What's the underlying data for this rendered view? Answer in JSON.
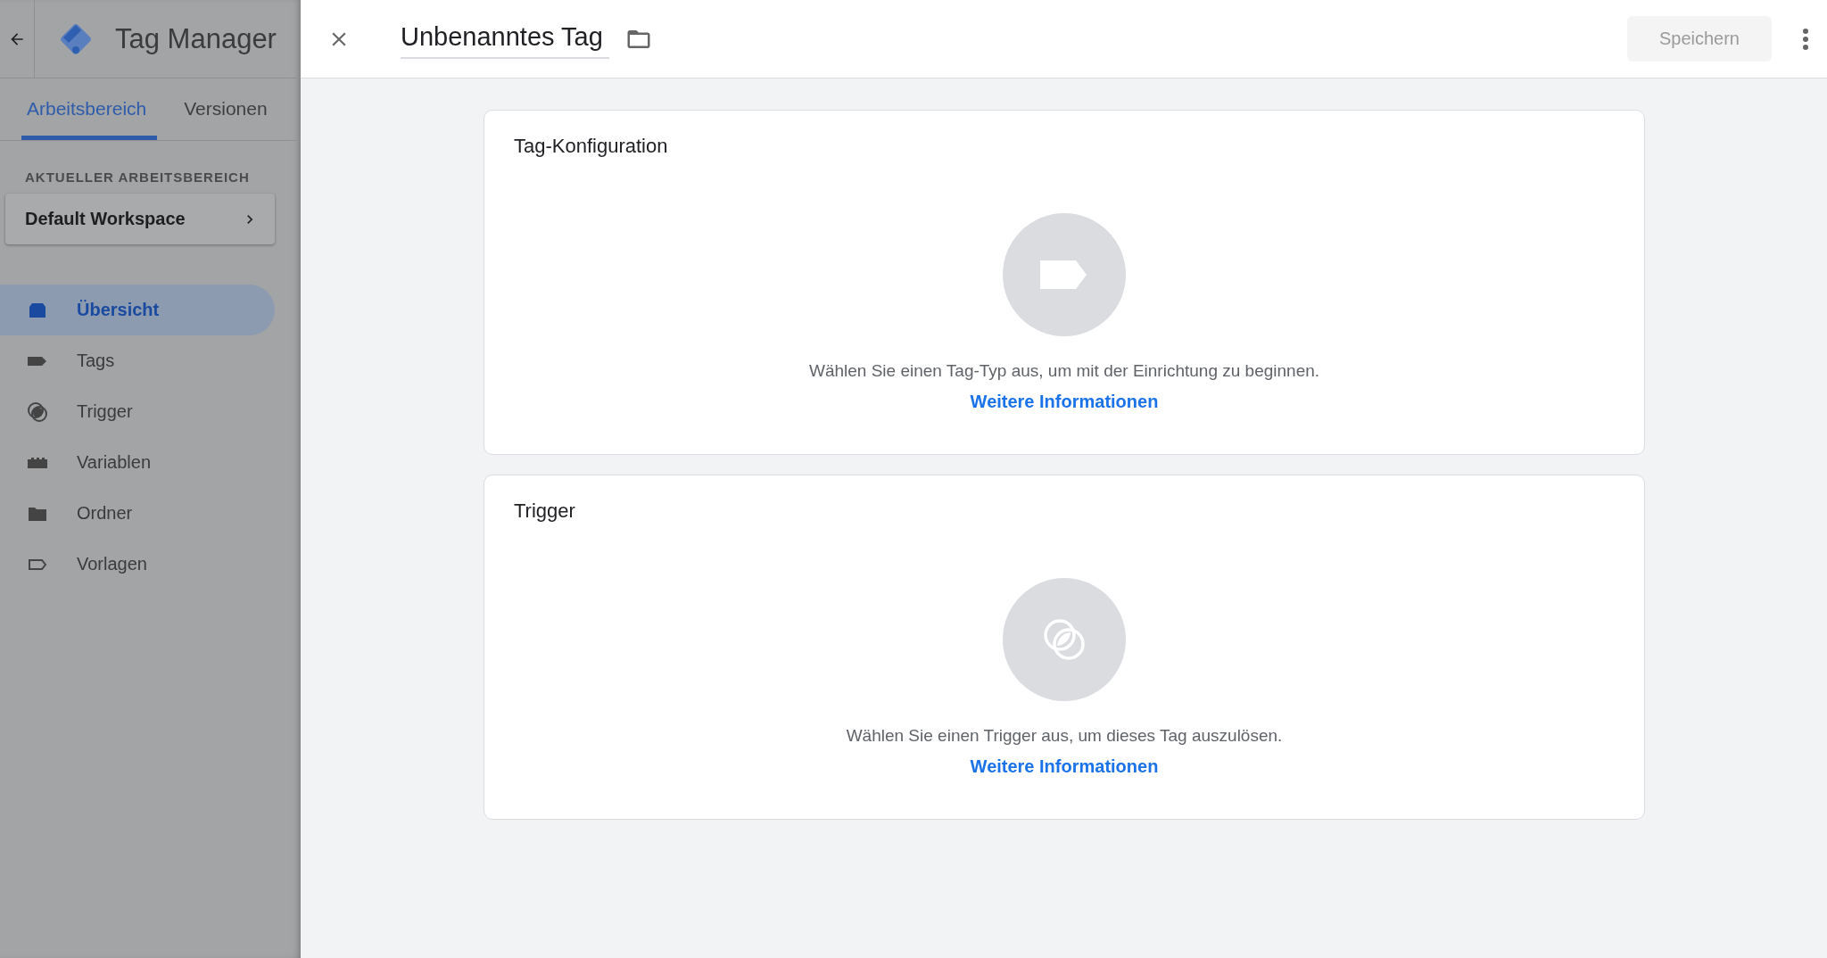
{
  "app": {
    "title": "Tag Manager"
  },
  "tabs": [
    {
      "label": "Arbeitsbereich",
      "selected": true
    },
    {
      "label": "Versionen",
      "selected": false
    }
  ],
  "workspace": {
    "section_label": "AKTUELLER ARBEITSBEREICH",
    "name": "Default Workspace"
  },
  "nav": [
    {
      "kind": "overview",
      "label": "Übersicht",
      "selected": true
    },
    {
      "kind": "tags",
      "label": "Tags",
      "selected": false
    },
    {
      "kind": "trigger",
      "label": "Trigger",
      "selected": false
    },
    {
      "kind": "variables",
      "label": "Variablen",
      "selected": false
    },
    {
      "kind": "folder",
      "label": "Ordner",
      "selected": false
    },
    {
      "kind": "templates",
      "label": "Vorlagen",
      "selected": false
    }
  ],
  "editor": {
    "title": "Unbenanntes Tag",
    "save_button": {
      "label": "Speichern",
      "disabled": true
    }
  },
  "cards": [
    {
      "kind": "tag",
      "title": "Tag-Konfiguration",
      "description": "Wählen Sie einen Tag-Typ aus, um mit der Einrichtung zu beginnen.",
      "link": "Weitere Informationen"
    },
    {
      "kind": "trigger",
      "title": "Trigger",
      "description": "Wählen Sie einen Trigger aus, um dieses Tag auszulösen.",
      "link": "Weitere Informationen"
    }
  ]
}
